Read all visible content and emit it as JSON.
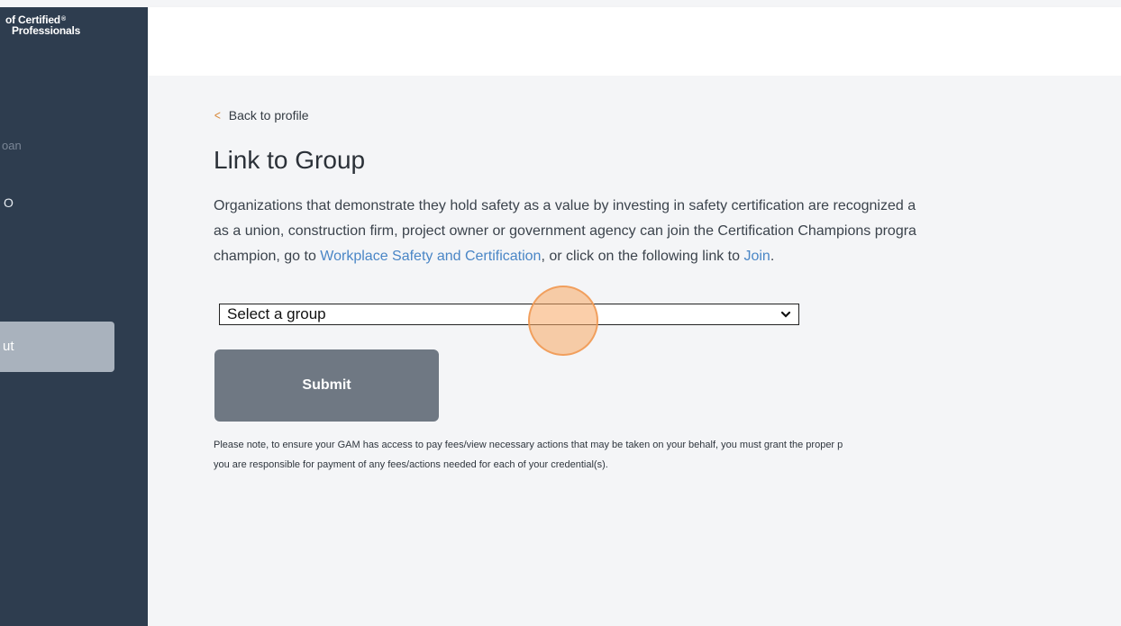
{
  "sidebar": {
    "logo_line1": "of Certified",
    "logo_reg": "®",
    "logo_line2": "Professionals",
    "faint_text": "oan",
    "small_text": "O",
    "button_label": "ut"
  },
  "main": {
    "back_icon": "chevron-left-icon",
    "back_label": "Back to profile",
    "title": "Link to Group",
    "intro": {
      "line1": "Organizations that demonstrate they hold safety as a value by investing in safety certification are recognized a",
      "line2": "as a union, construction firm, project owner or government agency can join the Certification Champions progra",
      "line3_prefix": "champion, go to ",
      "line3_link1": "Workplace Safety and Certification",
      "line3_middle": ", or click on the following link to ",
      "line3_link2": "Join",
      "line3_suffix": "."
    },
    "select": {
      "value": "Select a group",
      "arrow_icon": "chevron-down-icon"
    },
    "submit_label": "Submit",
    "note": {
      "line1": "Please note, to ensure your GAM has access to pay fees/view necessary actions that may be taken on your behalf, you must grant the proper p",
      "line2": "you are responsible for payment of any fees/actions needed for each of your credential(s)."
    }
  },
  "colors": {
    "sidebar_bg": "#2e3d4f",
    "link": "#4a86c6",
    "accent_chevron": "#d98a3c",
    "submit_bg": "#6f7883",
    "cursor_highlight": "#f7a864"
  }
}
